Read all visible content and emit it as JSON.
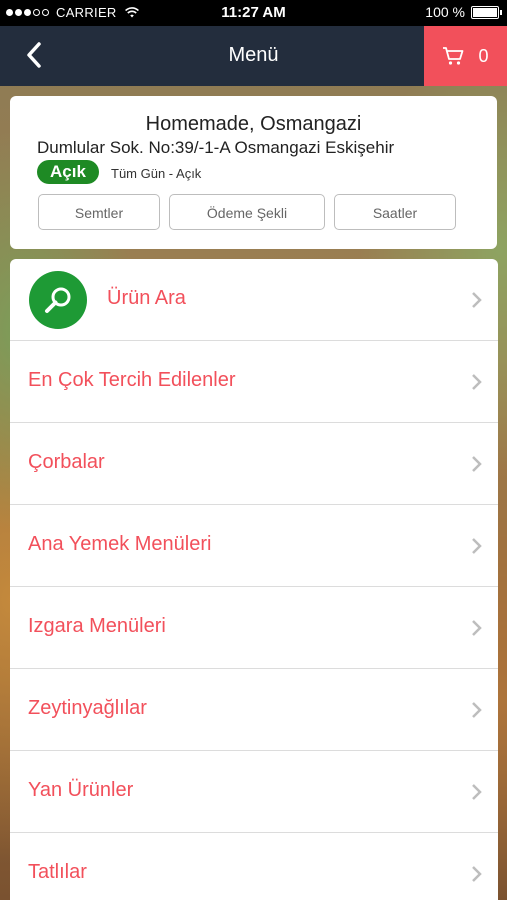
{
  "status_bar": {
    "carrier": "CARRIER",
    "time": "11:27 AM",
    "battery_label": "100 %"
  },
  "nav": {
    "title": "Menü",
    "cart_count": "0"
  },
  "restaurant": {
    "name": "Homemade, Osmangazi",
    "address": "Dumlular Sok. No:39/-1-A Osmangazi Eskişehir",
    "open_status": "Açık",
    "hours": "Tüm Gün - Açık",
    "buttons": [
      "Semtler",
      "Ödeme Şekli",
      "Saatler"
    ]
  },
  "menu": {
    "items": [
      {
        "label": "Ürün Ara"
      },
      {
        "label": "En Çok Tercih Edilenler"
      },
      {
        "label": "Çorbalar"
      },
      {
        "label": "Ana Yemek Menüleri"
      },
      {
        "label": "Izgara Menüleri"
      },
      {
        "label": "Zeytinyağlılar"
      },
      {
        "label": "Yan Ürünler"
      },
      {
        "label": "Tatlılar"
      }
    ]
  },
  "colors": {
    "accent": "#f2505b",
    "navbar": "#232d3d",
    "open_green": "#1e8a24"
  }
}
